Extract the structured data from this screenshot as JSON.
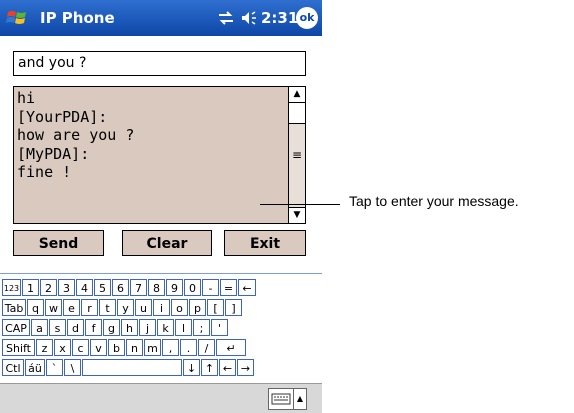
{
  "titlebar": {
    "app_title": "IP Phone",
    "time": "2:31",
    "ok_label": "ok"
  },
  "message_input": {
    "value": "and you ?"
  },
  "chat_log": {
    "text": "hi\n[YourPDA]:\nhow are you ?\n[MyPDA]:\nfine !"
  },
  "buttons": {
    "send": "Send",
    "clear": "Clear",
    "exit": "Exit"
  },
  "callout": {
    "text": "Tap to enter your message."
  },
  "keyboard": {
    "rows": [
      [
        "123",
        "1",
        "2",
        "3",
        "4",
        "5",
        "6",
        "7",
        "8",
        "9",
        "0",
        "-",
        "=",
        "←"
      ],
      [
        "Tab",
        "q",
        "w",
        "e",
        "r",
        "t",
        "y",
        "u",
        "i",
        "o",
        "p",
        "[",
        "]"
      ],
      [
        "CAP",
        "a",
        "s",
        "d",
        "f",
        "g",
        "h",
        "j",
        "k",
        "l",
        ";",
        "'"
      ],
      [
        "Shift",
        "z",
        "x",
        "c",
        "v",
        "b",
        "n",
        "m",
        ",",
        ".",
        "/",
        "↵"
      ],
      [
        "Ctl",
        "áü",
        "`",
        "\\",
        "",
        "↓",
        "↑",
        "←",
        "→"
      ]
    ]
  },
  "colors": {
    "titlebar": "#0d47a8",
    "panel": "#d9c9bf",
    "key_border": "#3d64c0"
  },
  "icons": [
    "windows-logo-icon",
    "connectivity-icon",
    "speaker-icon",
    "keyboard-icon"
  ]
}
